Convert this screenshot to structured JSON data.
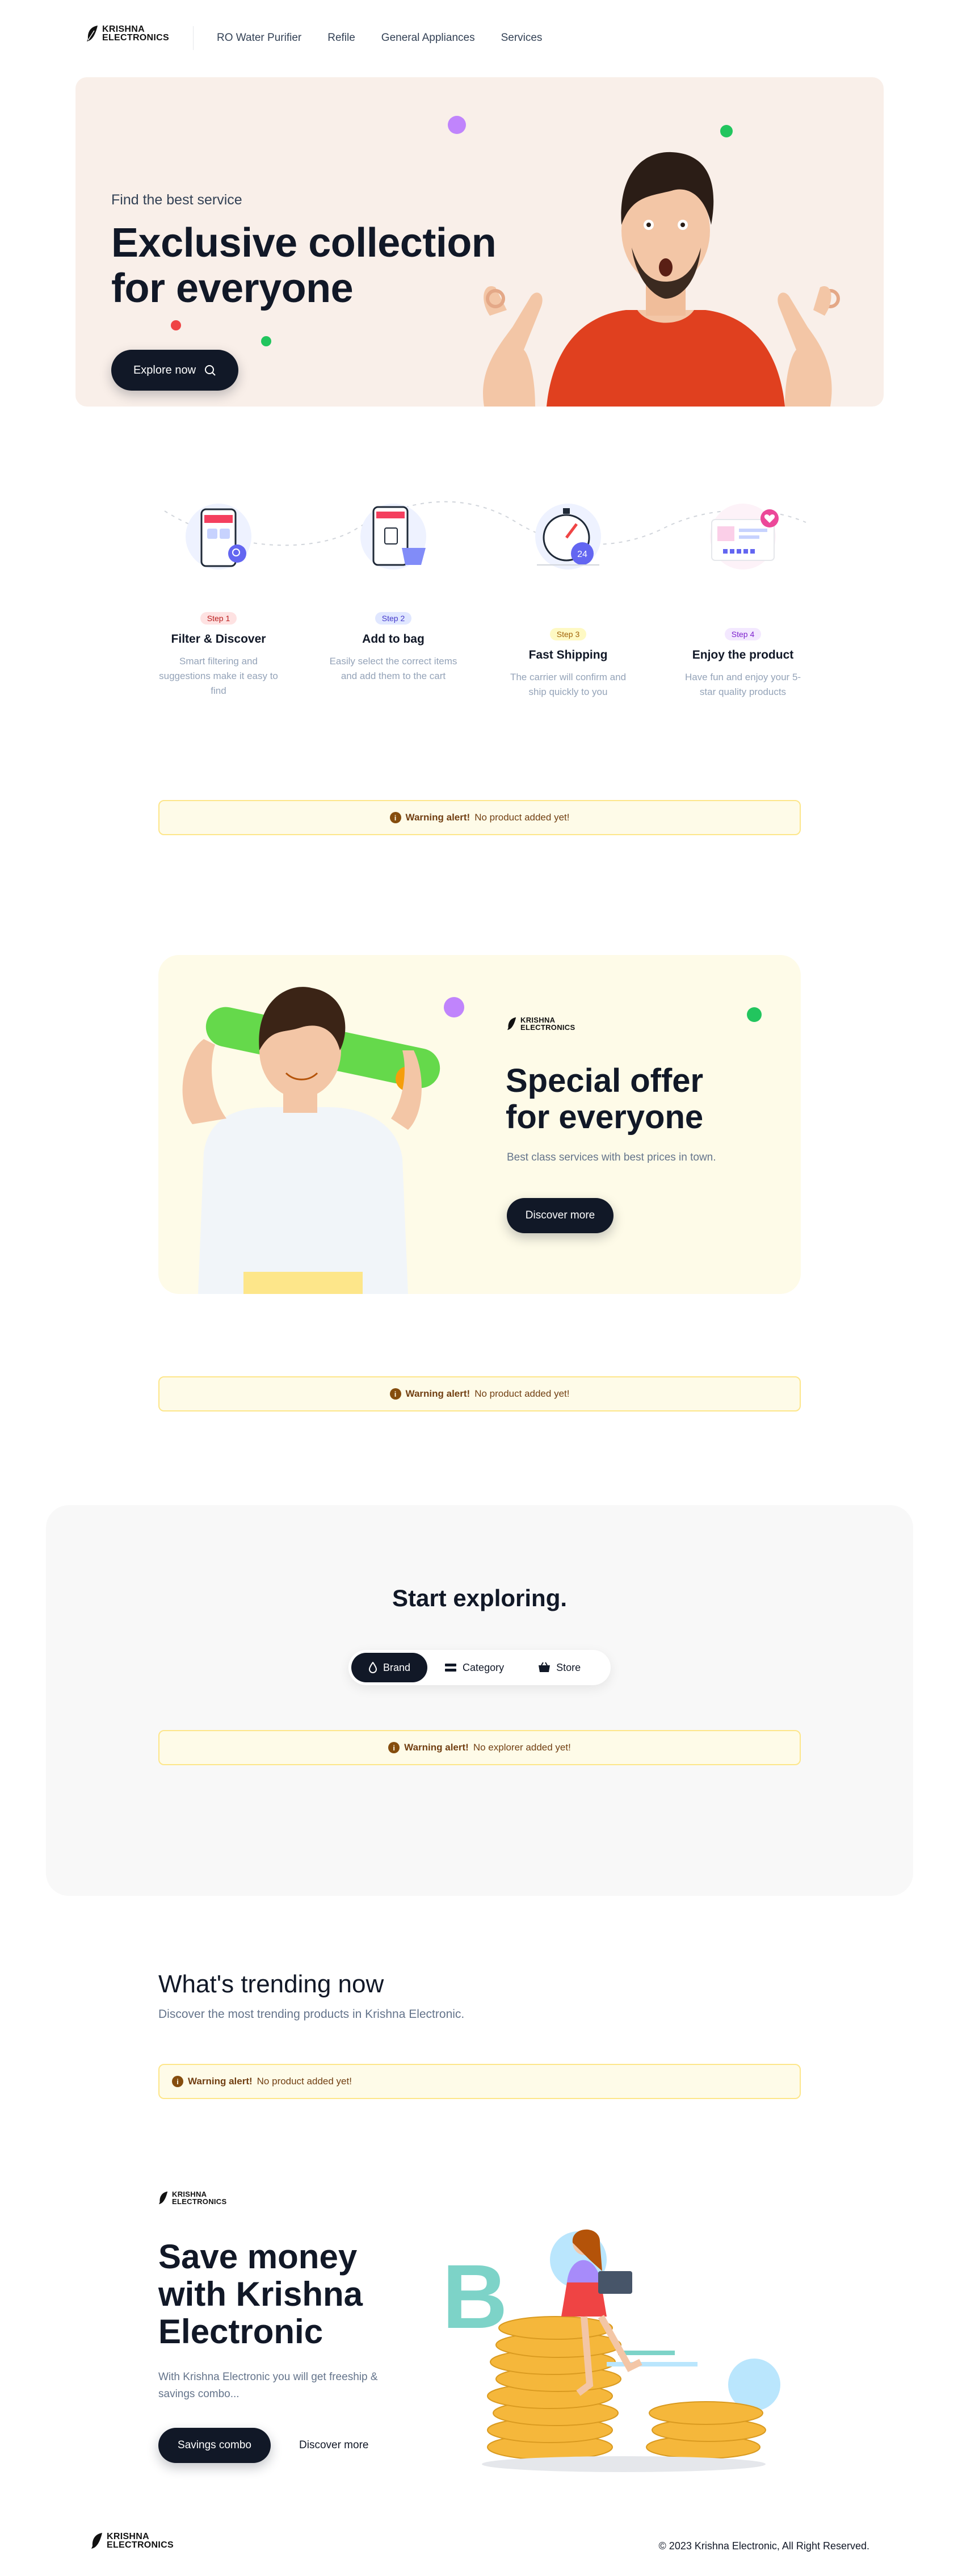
{
  "header": {
    "logo_line1": "KRISHNA",
    "logo_line2": "ELECTRONICS",
    "nav": [
      "RO Water Purifier",
      "Refile",
      "General Appliances",
      "Services"
    ]
  },
  "hero": {
    "eyebrow": "Find the best service",
    "title_line1": "Exclusive collection",
    "title_line2": "for everyone",
    "cta": "Explore now"
  },
  "steps": [
    {
      "badge": "Step 1",
      "title": "Filter & Discover",
      "desc": "Smart filtering and suggestions make it easy to find",
      "badge_bg": "#fee2e2",
      "badge_color": "#b91c1c"
    },
    {
      "badge": "Step 2",
      "title": "Add to bag",
      "desc": "Easily select the correct items and add them to the cart",
      "badge_bg": "#e0e7ff",
      "badge_color": "#4338ca"
    },
    {
      "badge": "Step 3",
      "title": "Fast Shipping",
      "desc": "The carrier will confirm and ship quickly to you",
      "badge_bg": "#fef9c3",
      "badge_color": "#a16207"
    },
    {
      "badge": "Step 4",
      "title": "Enjoy the product",
      "desc": "Have fun and enjoy your 5-star quality products",
      "badge_bg": "#f3e8ff",
      "badge_color": "#7e22ce"
    }
  ],
  "alerts": {
    "label": "Warning alert!",
    "no_product": "No product added yet!",
    "no_explorer": "No explorer added yet!"
  },
  "offer": {
    "logo_line1": "KRISHNA",
    "logo_line2": "ELECTRONICS",
    "title_line1": "Special offer",
    "title_line2": "for everyone",
    "subtitle": "Best class services with best prices in town.",
    "cta": "Discover more"
  },
  "explore": {
    "title": "Start exploring.",
    "tabs": [
      "Brand",
      "Category",
      "Store"
    ]
  },
  "trending": {
    "title": "What's trending now",
    "subtitle": "Discover the most trending products in Krishna Electronic."
  },
  "save": {
    "logo_line1": "KRISHNA",
    "logo_line2": "ELECTRONICS",
    "title_line1": "Save money",
    "title_line2": "with Krishna",
    "title_line3": "Electronic",
    "desc": "With Krishna Electronic you will get freeship & savings combo...",
    "cta_primary": "Savings combo",
    "cta_secondary": "Discover more"
  },
  "footer": {
    "logo_line1": "KRISHNA",
    "logo_line2": "ELECTRONICS",
    "copyright": "© 2023 Krishna Electronic, All Right Reserved."
  },
  "colors": {
    "dark": "#111827",
    "hero_bg": "#f9efe9",
    "offer_bg": "#fefbe8",
    "explore_bg": "#f8f8f8",
    "warning_bg": "#fefbe8",
    "warning_border": "#fde68a"
  },
  "icons": [
    "feather-logo-icon",
    "search-icon",
    "info-icon",
    "drop-icon",
    "category-icon",
    "store-icon"
  ]
}
